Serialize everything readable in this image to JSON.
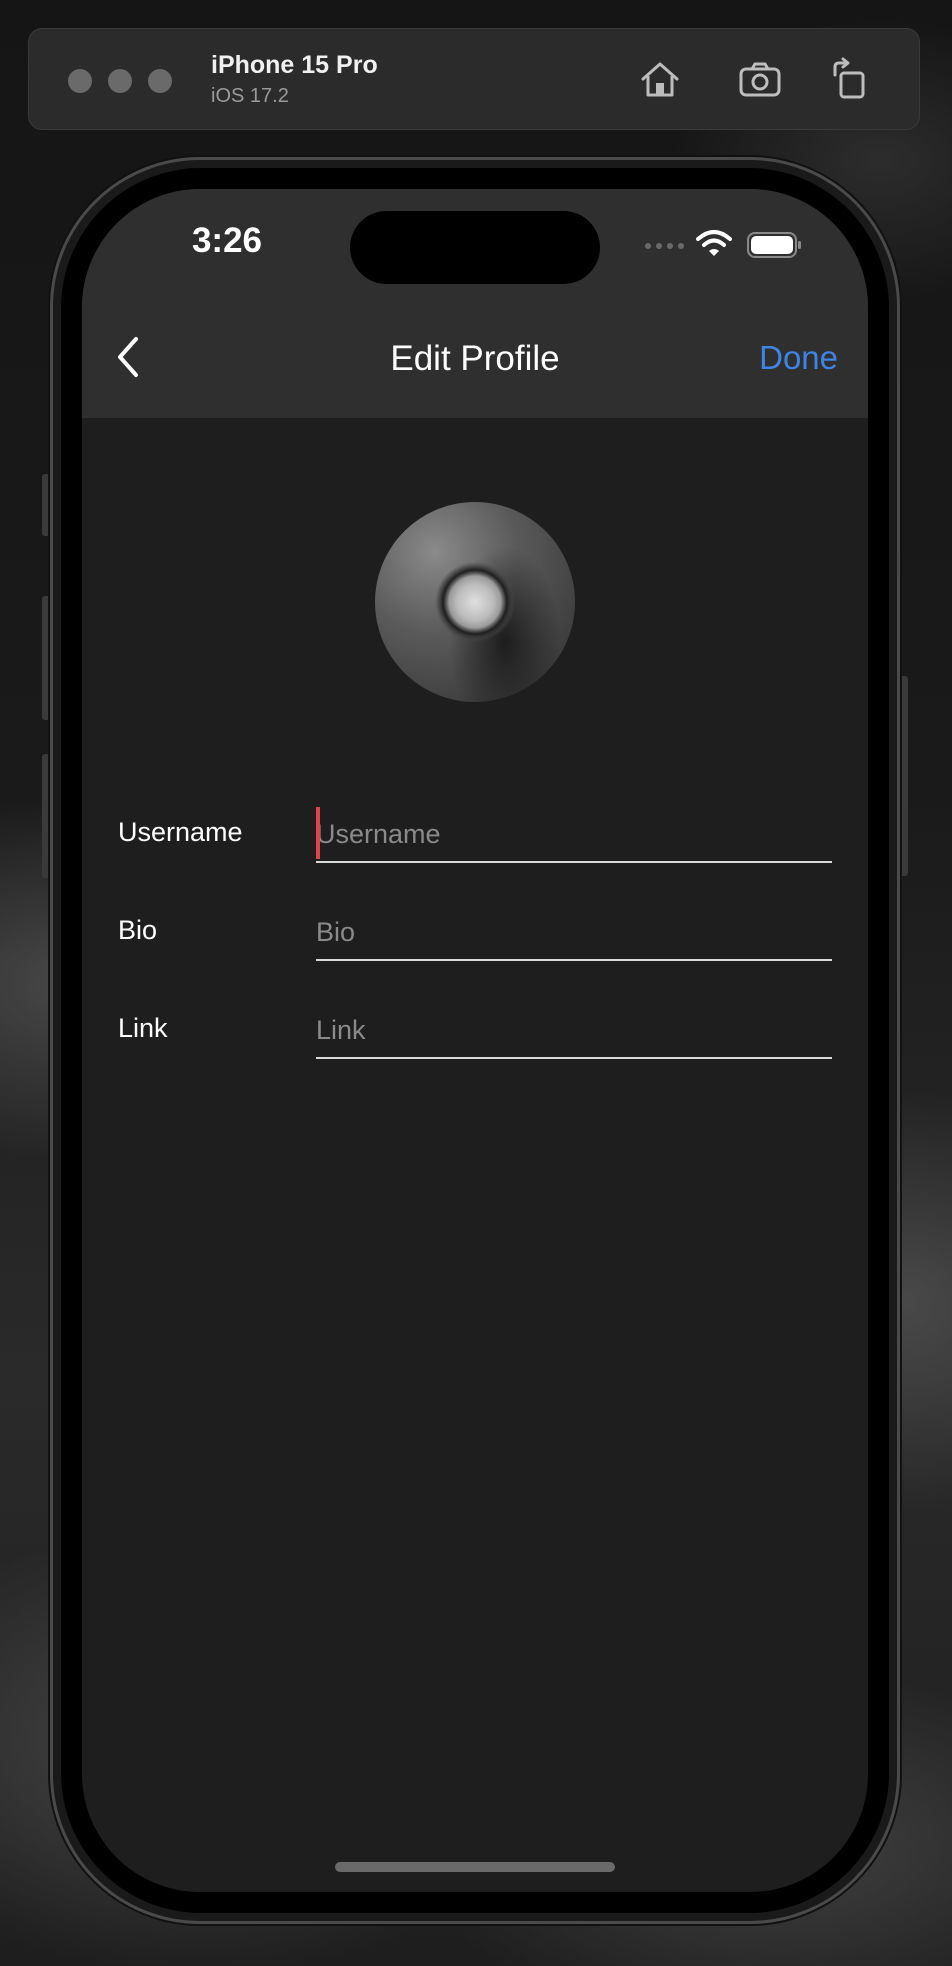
{
  "simulator": {
    "device_name": "iPhone 15 Pro",
    "os_version": "iOS 17.2",
    "toolbar_icons": [
      "home-icon",
      "screenshot-icon",
      "rotate-icon"
    ]
  },
  "status_bar": {
    "time": "3:26",
    "icons": [
      "cellular-icon",
      "wifi-icon",
      "battery-icon"
    ]
  },
  "nav": {
    "title": "Edit Profile",
    "done_label": "Done",
    "back_icon": "chevron-left-icon",
    "done_color": "#3f83e4"
  },
  "form": {
    "fields": [
      {
        "label": "Username",
        "value": "",
        "placeholder": "Username"
      },
      {
        "label": "Bio",
        "value": "",
        "placeholder": "Bio"
      },
      {
        "label": "Link",
        "value": "",
        "placeholder": "Link"
      }
    ]
  },
  "colors": {
    "cursor": "#e0424f",
    "background": "#1e1e1e",
    "nav_background": "#2f2f2f"
  }
}
